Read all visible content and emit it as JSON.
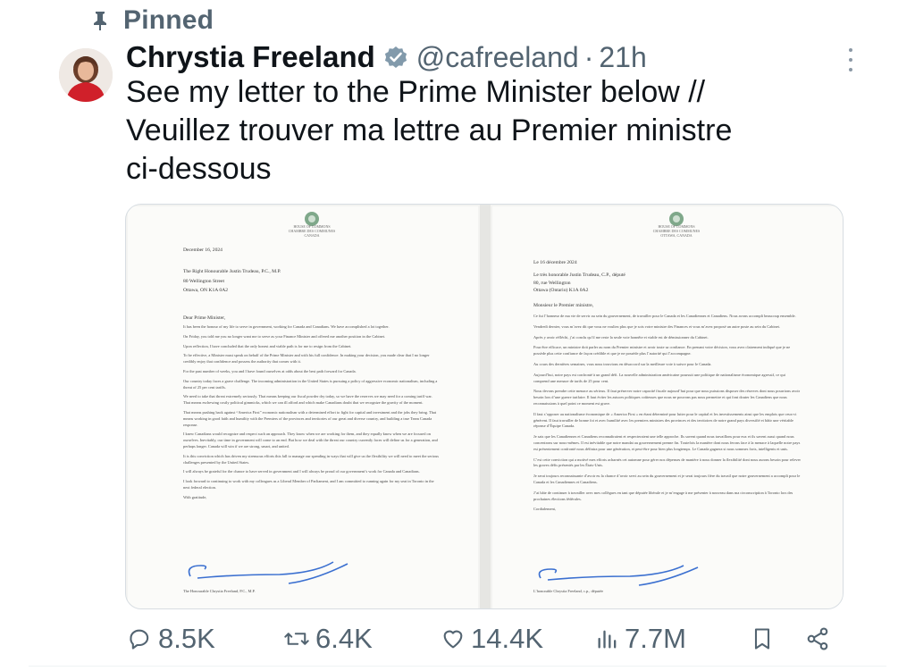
{
  "pinned": {
    "label": "Pinned",
    "icon": "pin-icon"
  },
  "author": {
    "display_name": "Chrystia Freeland",
    "handle": "@cafreeland",
    "separator": "·",
    "time": "21h",
    "verified_color": "#829aab"
  },
  "tweet": {
    "lines": [
      "See my letter to the Prime Minister below //",
      "Veuillez trouver ma lettre au Premier ministre",
      "ci-dessous"
    ]
  },
  "letter_en": {
    "letterhead": [
      "HOUSE OF COMMONS",
      "CHAMBRE DES COMMUNES",
      "CANADA"
    ],
    "date": "December 16, 2024",
    "address": [
      "The Right Honourable Justin Trudeau, P.C., M.P.",
      "80 Wellington Street",
      "Ottawa, ON K1A 0A2"
    ],
    "salutation": "Dear Prime Minister,",
    "paragraphs": [
      "It has been the honour of my life to serve in government, working for Canada and Canadians. We have accomplished a lot together.",
      "On Friday, you told me you no longer want me to serve as your Finance Minister and offered me another position in the Cabinet.",
      "Upon reflection, I have concluded that the only honest and viable path is for me to resign from the Cabinet.",
      "To be effective, a Minister must speak on behalf of the Prime Minister and with his full confidence. In making your decision, you made clear that I no longer credibly enjoy that confidence and possess the authority that comes with it.",
      "For the past number of weeks, you and I have found ourselves at odds about the best path forward for Canada.",
      "Our country today faces a grave challenge. The incoming administration in the United States is pursuing a policy of aggressive economic nationalism, including a threat of 25 per cent tariffs.",
      "We need to take that threat extremely seriously. That means keeping our fiscal powder dry today, so we have the reserves we may need for a coming tariff war. That means eschewing costly political gimmicks, which we can ill afford and which make Canadians doubt that we recognize the gravity of the moment.",
      "That means pushing back against “America First” economic nationalism with a determined effort to fight for capital and investment and the jobs they bring. That means working in good faith and humility with the Premiers of the provinces and territories of our great and diverse country, and building a true Team Canada response.",
      "I knew Canadians would recognize and respect such an approach. They know when we are working for them, and they equally know when we are focused on ourselves. Inevitably, our time in government will come to an end. But how we deal with the threat our country currently faces will define us for a generation, and perhaps longer. Canada will win if we are strong, smart, and united.",
      "It is this conviction which has driven my strenuous efforts this fall to manage our spending in ways that will give us the flexibility we will need to meet the serious challenges presented by the United States.",
      "I will always be grateful for the chance to have served in government and I will always be proud of our government’s work for Canada and Canadians.",
      "I look forward to continuing to work with my colleagues as a Liberal Member of Parliament, and I am committed to running again for my seat in Toronto in the next federal election."
    ],
    "closing": "With gratitude,",
    "signature_name": "The Honourable Chrystia Freeland, P.C., M.P."
  },
  "letter_fr": {
    "letterhead": [
      "HOUSE OF COMMONS",
      "CHAMBRE DES COMMUNES",
      "OTTAWA, CANADA"
    ],
    "date": "Le 16 décembre 2024",
    "address": [
      "Le très honorable Justin Trudeau, C.P., député",
      "80, rue Wellington",
      "Ottawa (Ontario) K1A 0A2"
    ],
    "salutation": "Monsieur le Premier ministre,",
    "paragraphs": [
      "Ce fut l’honneur de ma vie de servir au sein du gouvernement, de travailler pour le Canada et les Canadiennes et Canadiens. Nous avons accompli beaucoup ensemble.",
      "Vendredi dernier, vous m’avez dit que vous ne vouliez plus que je sois votre ministre des Finances et vous m’avez proposé un autre poste au sein du Cabinet.",
      "Après y avoir réfléchi, j’ai conclu qu’il me reste la seule voie honnête et viable est de démissionner du Cabinet.",
      "Pour être efficace, un ministre doit parler au nom du Premier ministre et avoir toute sa confiance. En prenant votre décision, vous avez clairement indiqué que je ne possède plus cette confiance de façon crédible et que je ne possède plus l’autorité qui l’accompagne.",
      "Au cours des dernières semaines, vous nous trouvions en désaccord sur la meilleure voie à suivre pour le Canada.",
      "Aujourd’hui, notre pays est confronté à un grand défi. La nouvelle administration américaine poursuit une politique de nationalisme économique agressif, ce qui comprend une menace de tarifs de 25 pour cent.",
      "Nous devons prendre cette menace au sérieux. Il faut préserver notre capacité fiscale aujourd’hui pour que nous puissions disposer des réserves dont nous pourrions avoir besoin lors d’une guerre tarifaire. Il faut éviter les astuces politiques coûteuses que nous ne pouvons pas nous permettre et qui font douter les Canadiens que nous reconnaissions à quel point ce moment est grave.",
      "Il faut s’opposer au nationalisme économique de « America First » en étant déterminé pour lutter pour le capital et les investissements ainsi que les emplois que ceux-ci génèrent. Il faut travailler de bonne foi et avec humilité avec les premiers ministres des provinces et des territoires de notre grand pays diversifié et bâtir une véritable réponse d’Équipe Canada.",
      "Je sais que les Canadiennes et Canadiens reconnaîtraient et respecteraient une telle approche. Ils savent quand nous travaillons pour eux et ils savent aussi quand nous concentrons sur nous-mêmes. Il est inévitable que notre mandat au gouvernement prenne fin. Toutefois la manière dont nous ferons face à la menace à laquelle notre pays est présentement confronté nous définira pour une génération, et peut-être pour bien plus longtemps. Le Canada gagnera si nous sommes forts, intelligents et unis.",
      "C’est cette conviction qui a motivé mes efforts acharnés cet automne pour gérer nos dépenses de manière à nous donner la flexibilité dont nous aurons besoin pour relever les graves défis présentés par les États-Unis.",
      "Je serai toujours reconnaissante d’avoir eu la chance d’avoir servi au sein du gouvernement et je serai toujours fière du travail que notre gouvernement a accompli pour le Canada et les Canadiennes et Canadiens.",
      "J’ai hâte de continuer à travailler avec mes collègues en tant que députée libérale et je m’engage à me présenter à nouveau dans ma circonscription à Toronto lors des prochaines élections fédérales."
    ],
    "closing": "Cordialement,",
    "signature_name": "L’honorable Chrystia Freeland, c.p., députée"
  },
  "actions": {
    "replies": {
      "count": "8.5K",
      "icon": "reply-icon"
    },
    "reposts": {
      "count": "6.4K",
      "icon": "repost-icon"
    },
    "likes": {
      "count": "14.4K",
      "icon": "like-icon"
    },
    "views": {
      "count": "7.7M",
      "icon": "views-icon"
    },
    "bookmark": {
      "icon": "bookmark-icon"
    },
    "share": {
      "icon": "share-icon"
    }
  }
}
